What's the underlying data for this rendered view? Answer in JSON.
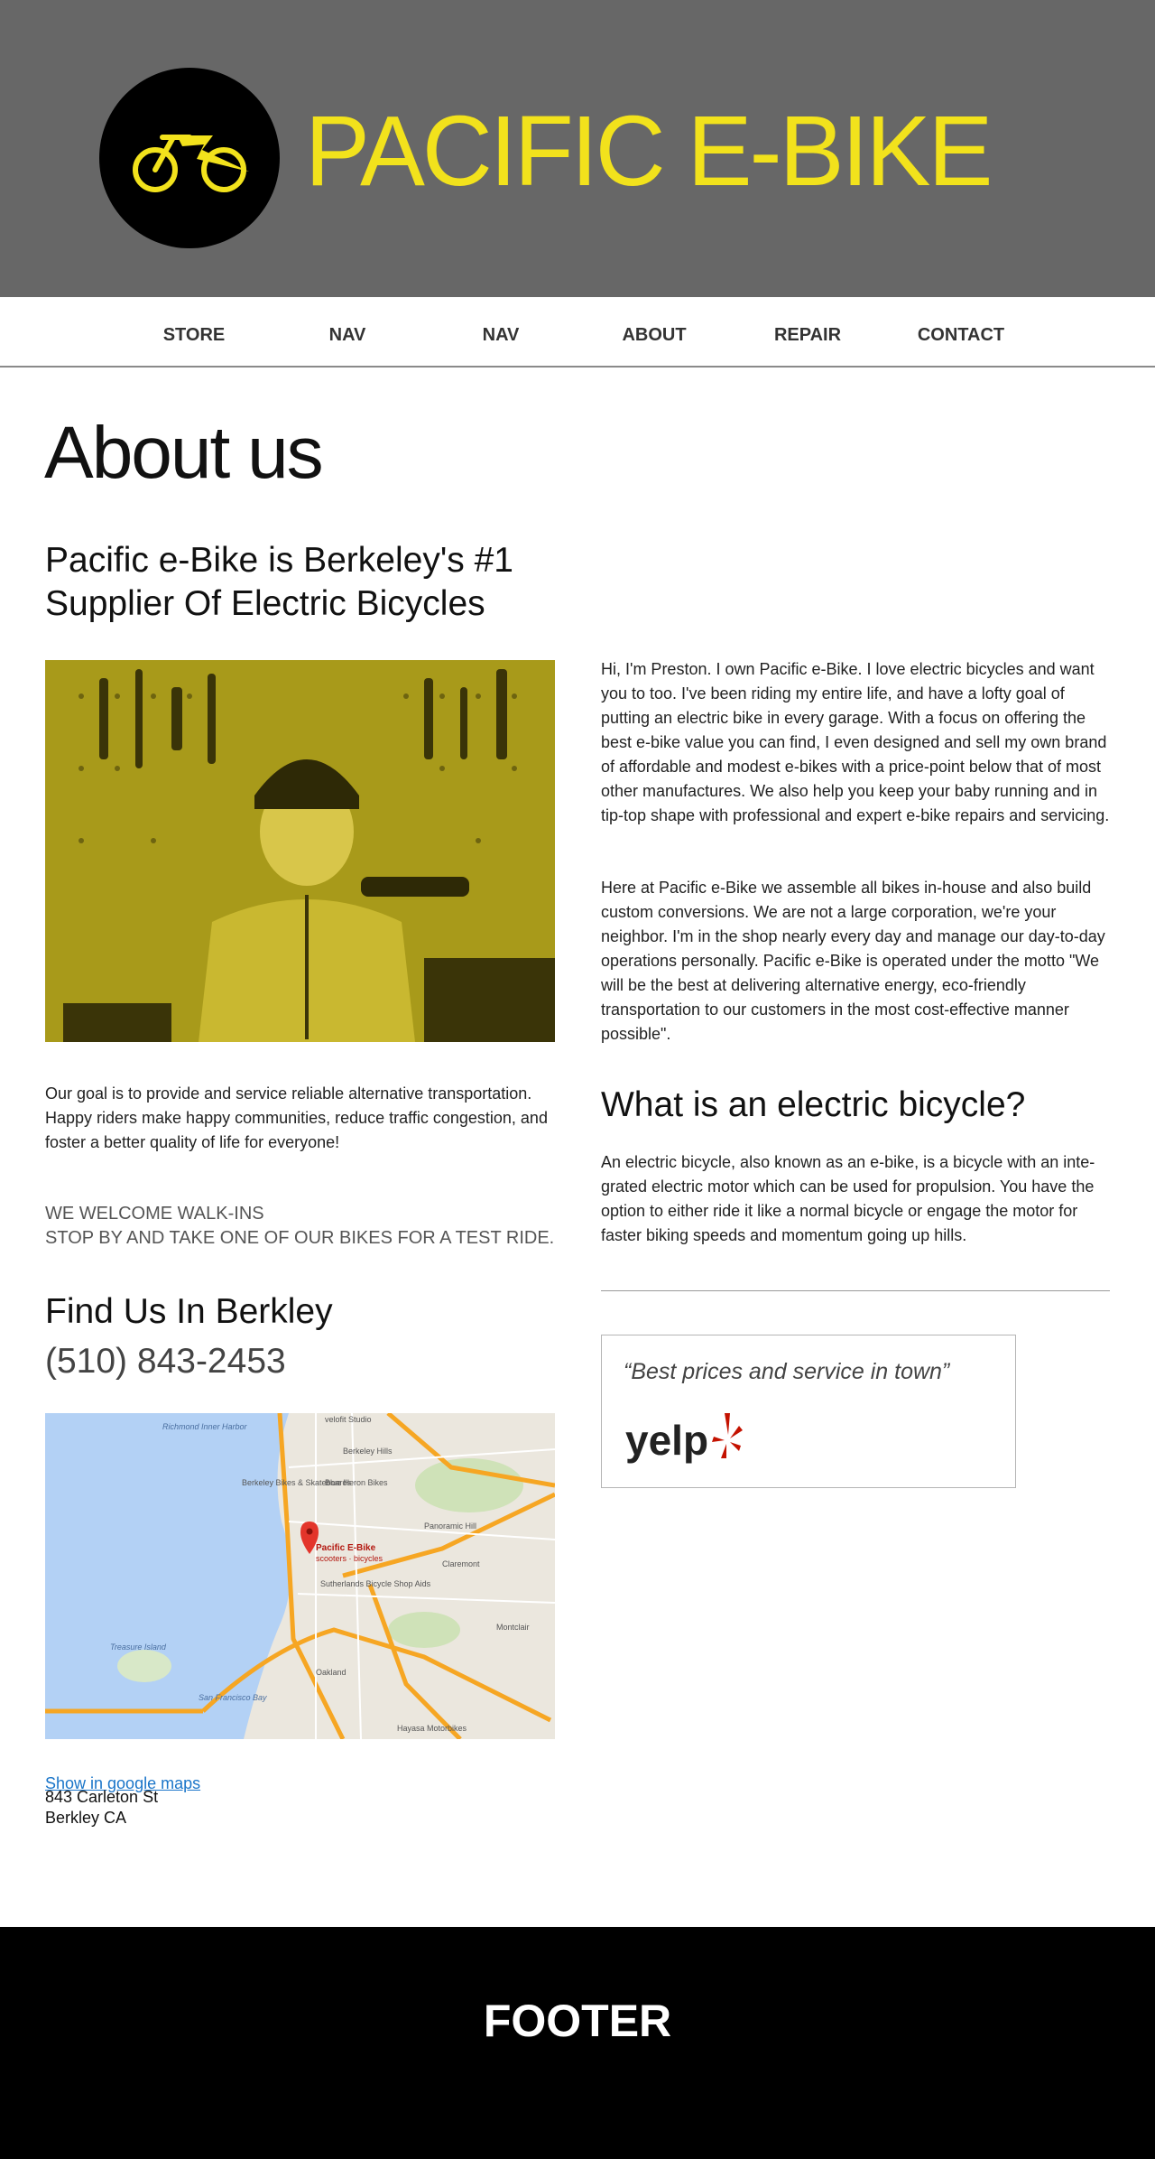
{
  "header": {
    "brand": "PACIFIC E-BIKE",
    "logo_icon": "ebike-logo-icon",
    "background_color": "#676767",
    "accent_color": "#f2e21c"
  },
  "nav": {
    "items": [
      {
        "label": "STORE"
      },
      {
        "label": "NAV"
      },
      {
        "label": "NAV"
      },
      {
        "label": "ABOUT"
      },
      {
        "label": "REPAIR"
      },
      {
        "label": "CONTACT"
      }
    ]
  },
  "main": {
    "title": "About us",
    "lead": "Pacific e-Bike is Berkeley's #1 Supplier Of Electric Bicycles",
    "intro_paragraph_1": "Hi, I'm Preston. I own Pacific e-Bike. I love electric bicycles and want you to too. I've been riding my entire life, and have a lofty goal of putting an electric bike in every garage. With a focus on offering the best e-bike value you can find, I even designed and sell my own brand of affordable and modest e-bikes with a price-point below that of most other manufactures. We also help you keep your baby running and in tip-top shape with professional and expert e-bike repairs and servicing.",
    "intro_paragraph_2": "Here at Pacific e-Bike we assemble all bikes in-house and also build custom conversions. We are not a large corporation, we're your neighbor. I'm in the shop nearly every day and manage our day-to-day operations personally. Pacific e-Bike is operated under the motto \"We will be the best at delivering alternative energy, eco-friendly transportation to our customers in the most cost-effective manner possible\".",
    "goal": "Our goal is to provide and service reliable alternative transportation. Happy riders make happy communities, reduce traffic congestion, and foster a better quality of life for everyone!",
    "walkins_line_1": "WE WELCOME WALK-INS",
    "walkins_line_2": "STOP BY AND TAKE ONE OF OUR BIKES FOR A TEST RIDE.",
    "what_heading": "What is an electric bicycle?",
    "what_text": "An electric bicycle, also known as an e-bike, is a bicycle with an inte-grated electric motor which can be used for propulsion. You have the option to either ride it like a normal bicycle or engage the motor for faster biking speeds and momentum going up hills.",
    "review_quote": "“Best prices and service in town”",
    "review_logo": "yelp"
  },
  "find": {
    "heading": "Find Us In Berkley",
    "phone": "(510) 843-2453",
    "map_link": "Show in google maps",
    "address_line_1": "843 Carleton St",
    "address_line_2": "Berkley CA",
    "map_labels": {
      "pin": "Pacific E-Bike",
      "pin_sub": "scooters · bicycles",
      "poi_1": "velofit Studio",
      "poi_2": "Berkeley Hills",
      "poi_3": "Richmond Inner Harbor",
      "poi_4": "Berkeley Bikes & Skateboards",
      "poi_5": "Blue Heron Bikes",
      "poi_6": "Panoramic Hill",
      "poi_7": "Sutherlands Bicycle Shop Aids",
      "poi_8": "Claremont",
      "poi_9": "Treasure Island",
      "poi_10": "San Francisco Bay",
      "poi_11": "Hayasa Motorbikes",
      "poi_12": "Oakland",
      "poi_13": "Montclair"
    }
  },
  "footer": {
    "label": "FOOTER"
  }
}
